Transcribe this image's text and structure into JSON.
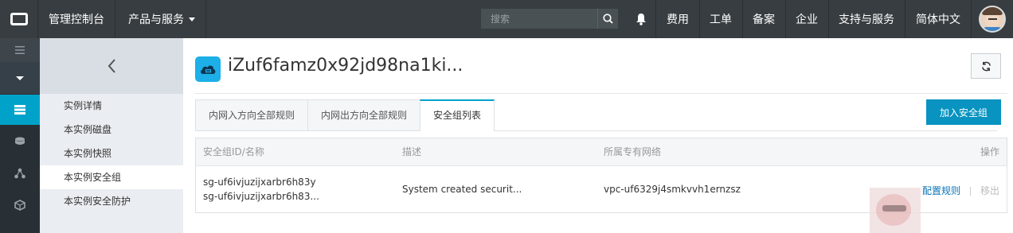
{
  "topbar": {
    "console": "管理控制台",
    "products": "产品与服务",
    "search_placeholder": "搜索",
    "links": [
      "费用",
      "工单",
      "备案",
      "企业",
      "支持与服务",
      "简体中文"
    ]
  },
  "sidebar": {
    "items": [
      "实例详情",
      "本实例磁盘",
      "本实例快照",
      "本实例安全组",
      "本实例安全防护"
    ],
    "active_index": 3
  },
  "header": {
    "title": "iZuf6famz0x92jd98na1ki..."
  },
  "tabs": [
    "内网入方向全部规则",
    "内网出方向全部规则",
    "安全组列表"
  ],
  "active_tab": 2,
  "actions": {
    "add_group": "加入安全组"
  },
  "table": {
    "columns": [
      "安全组ID/名称",
      "描述",
      "所属专有网络",
      "操作"
    ],
    "rows": [
      {
        "id": "sg-uf6ivjuzijxarbr6h83y",
        "name": "sg-uf6ivjuzijxarbr6h83...",
        "description": "System created securit...",
        "vpc": "vpc-uf6329j4smkvvh1ernzsz",
        "op_configure": "配置规则",
        "op_remove": "移出"
      }
    ]
  },
  "colors": {
    "topbar": "#373d41",
    "accent": "#00a2ca",
    "primary_button": "#0893c0",
    "link": "#0a73b7"
  }
}
